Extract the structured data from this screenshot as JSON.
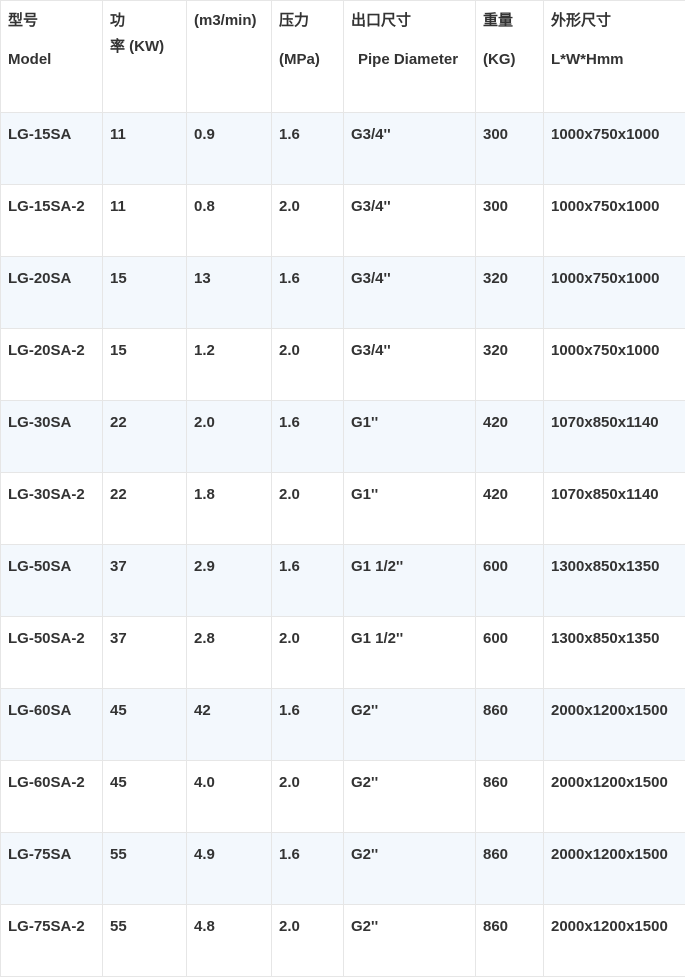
{
  "table": {
    "header": [
      {
        "line1": "型号",
        "line2": "Model"
      },
      {
        "line1": "功",
        "line2": "率 (KW)"
      },
      {
        "line1": "(m3/min)",
        "line2": ""
      },
      {
        "line1": "压力",
        "line2": "(MPa)"
      },
      {
        "line1": "出口尺寸",
        "line2": "Pipe Diameter"
      },
      {
        "line1": "重量",
        "line2": "(KG)"
      },
      {
        "line1": "外形尺寸",
        "line2": "L*W*Hmm"
      }
    ],
    "rows": [
      [
        "LG-15SA",
        "11",
        "0.9",
        "1.6",
        "G3/4''",
        "300",
        "1000x750x1000"
      ],
      [
        "LG-15SA-2",
        "11",
        "0.8",
        "2.0",
        "G3/4''",
        "300",
        "1000x750x1000"
      ],
      [
        "LG-20SA",
        "15",
        "13",
        "1.6",
        "G3/4''",
        "320",
        "1000x750x1000"
      ],
      [
        "LG-20SA-2",
        "15",
        "1.2",
        "2.0",
        "G3/4''",
        "320",
        "1000x750x1000"
      ],
      [
        "LG-30SA",
        "22",
        "2.0",
        "1.6",
        "G1''",
        "420",
        "1070x850x1140"
      ],
      [
        "LG-30SA-2",
        "22",
        "1.8",
        "2.0",
        "G1''",
        "420",
        "1070x850x1140"
      ],
      [
        "LG-50SA",
        "37",
        "2.9",
        "1.6",
        "G1 1/2''",
        "600",
        "1300x850x1350"
      ],
      [
        "LG-50SA-2",
        "37",
        "2.8",
        "2.0",
        "G1 1/2''",
        "600",
        "1300x850x1350"
      ],
      [
        "LG-60SA",
        "45",
        "42",
        "1.6",
        "G2''",
        "860",
        "2000x1200x1500"
      ],
      [
        "LG-60SA-2",
        "45",
        "4.0",
        "2.0",
        "G2''",
        "860",
        "2000x1200x1500"
      ],
      [
        "LG-75SA",
        "55",
        "4.9",
        "1.6",
        "G2''",
        "860",
        "2000x1200x1500"
      ],
      [
        "LG-75SA-2",
        "55",
        "4.8",
        "2.0",
        "G2''",
        "860",
        "2000x1200x1500"
      ]
    ]
  }
}
